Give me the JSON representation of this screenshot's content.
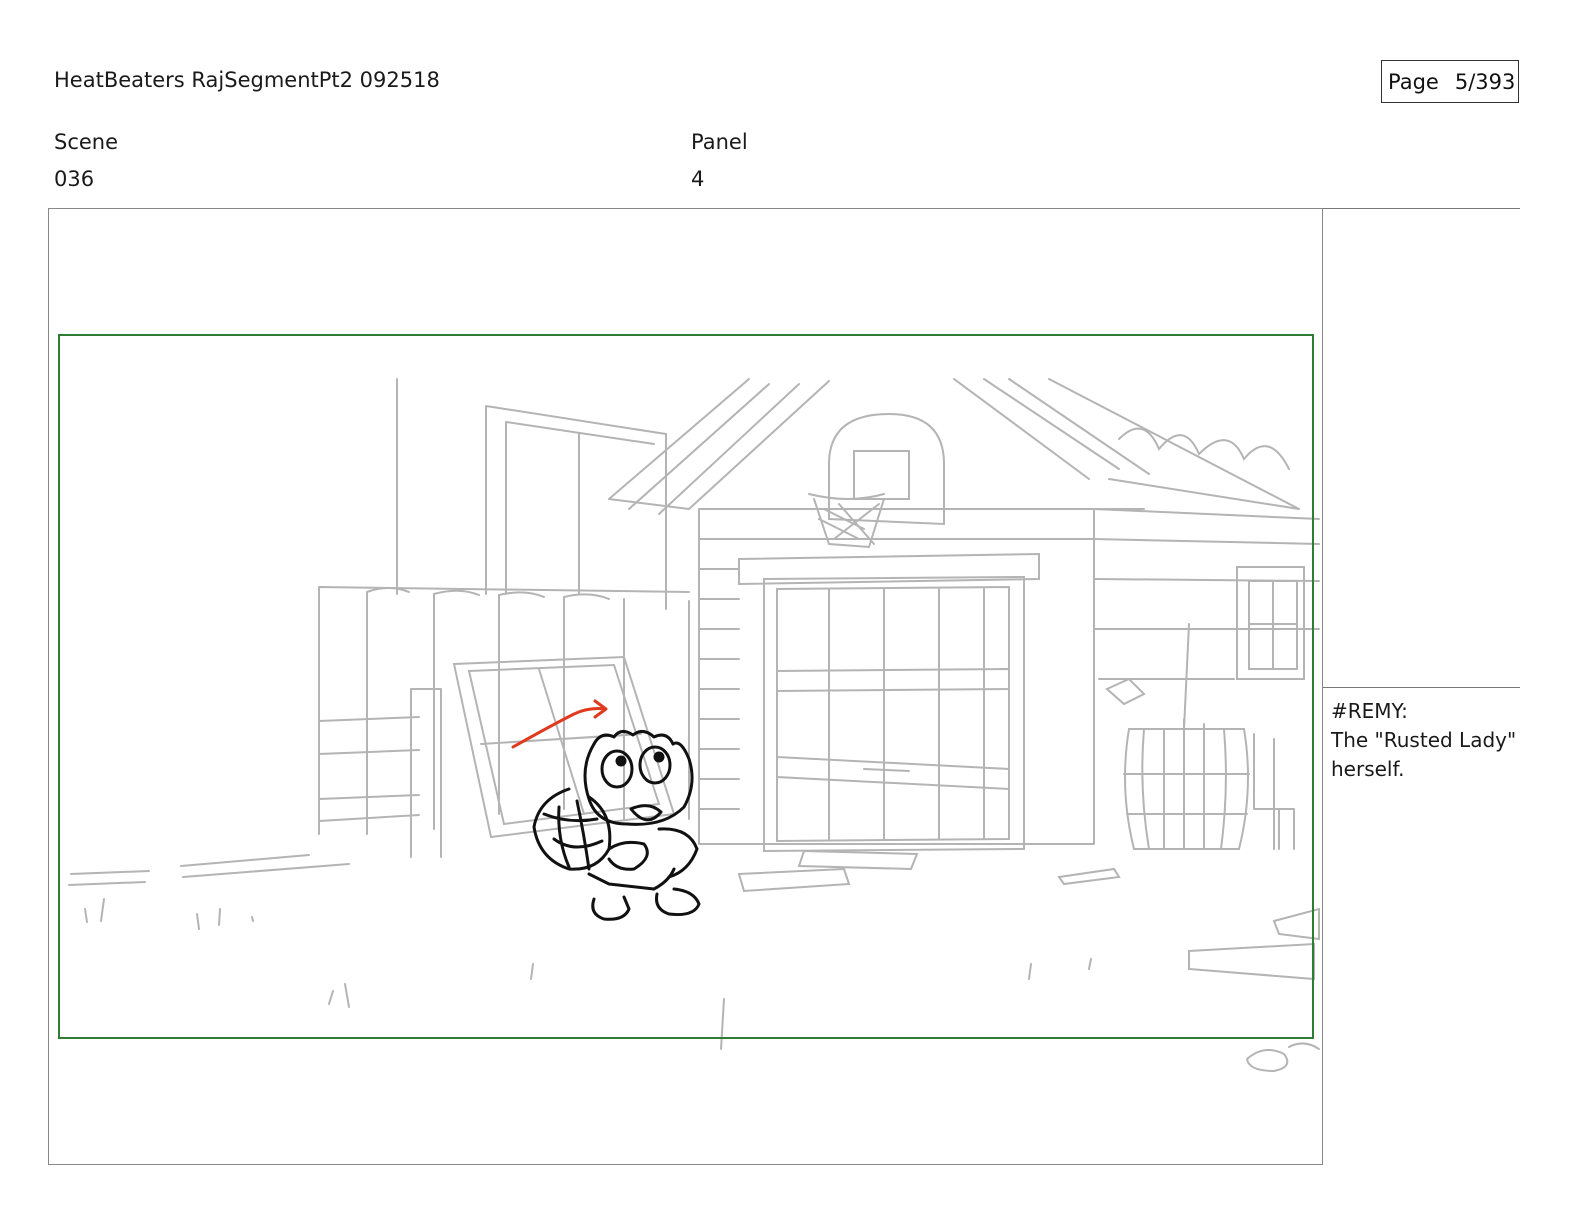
{
  "header": {
    "title": "HeatBeaters RajSegmentPt2 092518",
    "page_label": "Page",
    "page_number": "5/393"
  },
  "scene": {
    "label": "Scene",
    "value": "036"
  },
  "panel": {
    "label": "Panel",
    "value": "4"
  },
  "notes": {
    "speaker": "#REMY:",
    "lines": [
      "The \"Rusted Lady\"",
      "herself."
    ]
  },
  "colors": {
    "safe_area_border": "#2e7d32",
    "action_arrow": "#e03a1e",
    "background_lines": "#b4b4b4",
    "character_lines": "#111111"
  }
}
